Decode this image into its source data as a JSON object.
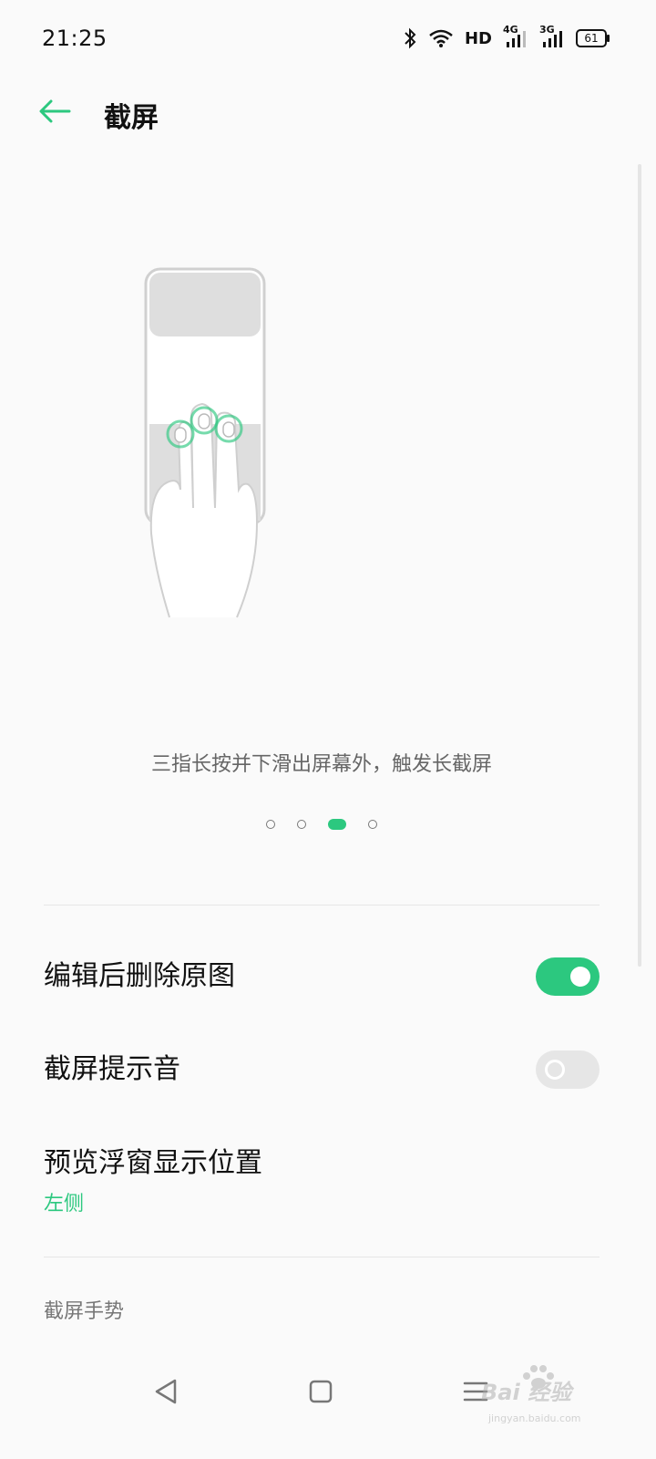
{
  "status_bar": {
    "time": "21:25",
    "network_hd": "HD",
    "network_4g": "4G",
    "network_3g": "3G",
    "battery": "61",
    "icons": [
      "bluetooth-icon",
      "wifi-icon",
      "hd-icon",
      "signal-4g-icon",
      "signal-3g-icon",
      "battery-icon"
    ]
  },
  "header": {
    "title": "截屏",
    "back_icon": "back-arrow-icon"
  },
  "tutorial": {
    "tip": "三指长按并下滑出屏幕外，触发长截屏",
    "page_count": 4,
    "active_page": 3
  },
  "settings": [
    {
      "label": "编辑后删除原图",
      "toggle": true
    },
    {
      "label": "截屏提示音",
      "toggle": false
    },
    {
      "label": "预览浮窗显示位置",
      "value": "左侧"
    }
  ],
  "section": {
    "title": "截屏手势"
  },
  "nav": {
    "buttons": [
      "back-triangle-icon",
      "home-square-icon",
      "menu-lines-icon"
    ]
  },
  "watermark": {
    "brand": "Bai  经验",
    "url": "jingyan.baidu.com"
  },
  "colors": {
    "accent": "#2cc87f",
    "background": "#fafafa",
    "toggle_off": "#e6e6e6"
  }
}
